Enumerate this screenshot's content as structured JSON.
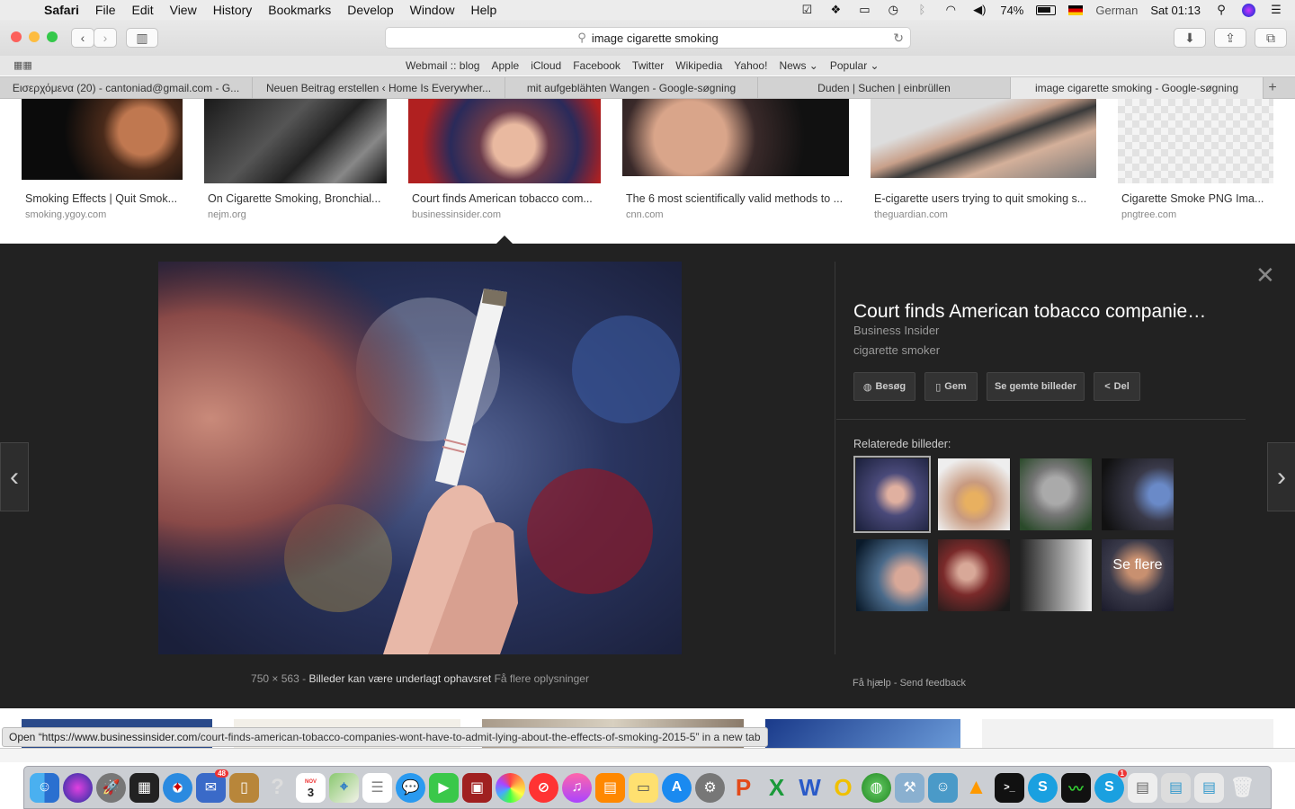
{
  "menubar": {
    "apple": "",
    "items": [
      "Safari",
      "File",
      "Edit",
      "View",
      "History",
      "Bookmarks",
      "Develop",
      "Window",
      "Help"
    ],
    "battery": "74%",
    "language": "German",
    "clock": "Sat 01:13"
  },
  "toolbar": {
    "address": "image cigarette smoking"
  },
  "favorites": [
    "Webmail :: blog",
    "Apple",
    "iCloud",
    "Facebook",
    "Twitter",
    "Wikipedia",
    "Yahoo!",
    "News ⌄",
    "Popular ⌄"
  ],
  "tabs": [
    {
      "label": "Εισερχόμενα (20) - cantoniad@gmail.com - G..."
    },
    {
      "label": "Neuen Beitrag erstellen ‹ Home Is Everywher..."
    },
    {
      "label": "mit aufgeblähten Wangen - Google-søgning"
    },
    {
      "label": "Duden | Suchen | einbrüllen"
    },
    {
      "label": "image cigarette smoking - Google-søgning"
    }
  ],
  "results": [
    {
      "caption": "Smoking Effects | Quit Smok...",
      "source": "smoking.ygoy.com"
    },
    {
      "caption": "On Cigarette Smoking, Bronchial...",
      "source": "nejm.org"
    },
    {
      "caption": "Court finds American tobacco com...",
      "source": "businessinsider.com"
    },
    {
      "caption": "The 6 most scientifically valid methods to ...",
      "source": "cnn.com"
    },
    {
      "caption": "E-cigarette users trying to quit smoking s...",
      "source": "theguardian.com"
    },
    {
      "caption": "Cigarette Smoke PNG Ima...",
      "source": "pngtree.com"
    }
  ],
  "preview": {
    "title": "Court finds American tobacco companie…",
    "site": "Business Insider",
    "description": "cigarette smoker",
    "buttons": {
      "visit": "Besøg",
      "save": "Gem",
      "saved": "Se gemte billeder",
      "share": "Del"
    },
    "related_label": "Relaterede billeder:",
    "see_more": "Se flere",
    "dimensions": "750 × 563",
    "copyright": "Billeder kan være underlagt ophavsret",
    "more_info": "Få flere oplysninger",
    "help": "Få hjælp",
    "feedback": "Send feedback",
    "sep": "-"
  },
  "status": {
    "prefix": "Open “https://www.businessinsider.com",
    "path": "/court-finds-american-tobacco-companies-wont-have-to-admit-lying-about-the-effects-of-smoking-2015-5” in a new tab"
  },
  "dock": {
    "calendar_month": "NOV",
    "calendar_day": "3",
    "mail_badge": "48",
    "skype_badge": "1"
  }
}
